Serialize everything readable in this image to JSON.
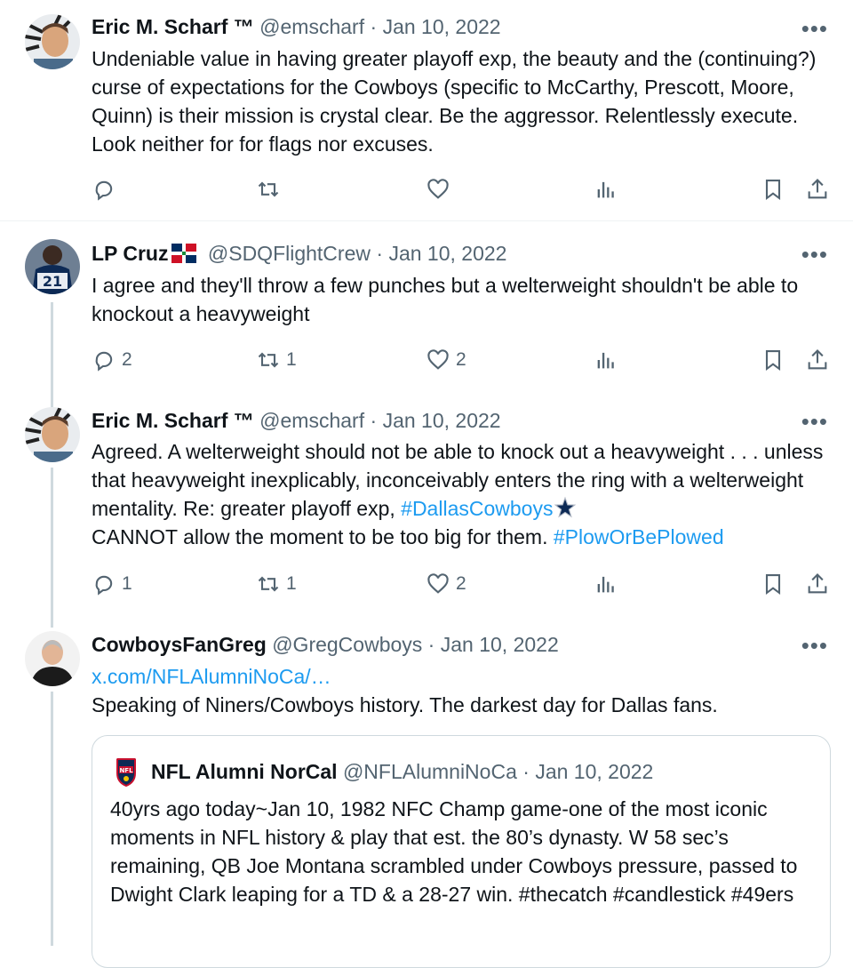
{
  "tweets": [
    {
      "name": "Eric M. Scharf ™",
      "handle": "@emscharf",
      "sep": "·",
      "date": "Jan 10, 2022",
      "text": "Undeniable value in having greater playoff exp, the beauty and the (continuing?) curse of expectations for the Cowboys (specific to McCarthy, Prescott, Moore, Quinn) is their mission is crystal clear. Be the aggressor. Relentlessly execute. Look neither for for flags nor excuses.",
      "replies": "",
      "retweets": "",
      "likes": ""
    },
    {
      "name": "LP Cruz",
      "flag_icon": "dominican-flag-icon",
      "handle": "@SDQFlightCrew",
      "sep": "·",
      "date": "Jan 10, 2022",
      "text": "I agree and they'll throw a few punches but a welterweight shouldn't be able to knockout a heavyweight",
      "replies": "2",
      "retweets": "1",
      "likes": "2"
    },
    {
      "name": "Eric M. Scharf ™",
      "handle": "@emscharf",
      "sep": "·",
      "date": "Jan 10, 2022",
      "text_part1": "Agreed. A welterweight should not be able to knock out a heavyweight . . . unless that heavyweight inexplicably, inconceivably enters the ring with a welterweight mentality. Re: greater playoff exp, ",
      "hashtag1": "#DallasCowboys",
      "text_part2": "CANNOT allow the moment to be too big for them. ",
      "hashtag2": "#PlowOrBePlowed",
      "replies": "1",
      "retweets": "1",
      "likes": "2"
    },
    {
      "name": "CowboysFanGreg",
      "handle": "@GregCowboys",
      "sep": "·",
      "date": "Jan 10, 2022",
      "link": "x.com/NFLAlumniNoCa/…",
      "text": "Speaking of Niners/Cowboys history. The darkest day for Dallas fans."
    }
  ],
  "quote": {
    "name": "NFL Alumni NorCal",
    "handle": "@NFLAlumniNoCa",
    "sep": "·",
    "date": "Jan 10, 2022",
    "text": "40yrs ago today~Jan 10, 1982 NFC Champ game-one of the most iconic moments in NFL history & play that est. the 80’s dynasty. W 58 sec’s remaining, QB Joe Montana scrambled under Cowboys pressure, passed to Dwight Clark leaping for a TD & a 28-27 win. #thecatch #candlestick #49ers"
  },
  "more_label": "•••",
  "colors": {
    "link": "#1d9bf0",
    "muted": "#536471",
    "line": "#cfd9de"
  }
}
